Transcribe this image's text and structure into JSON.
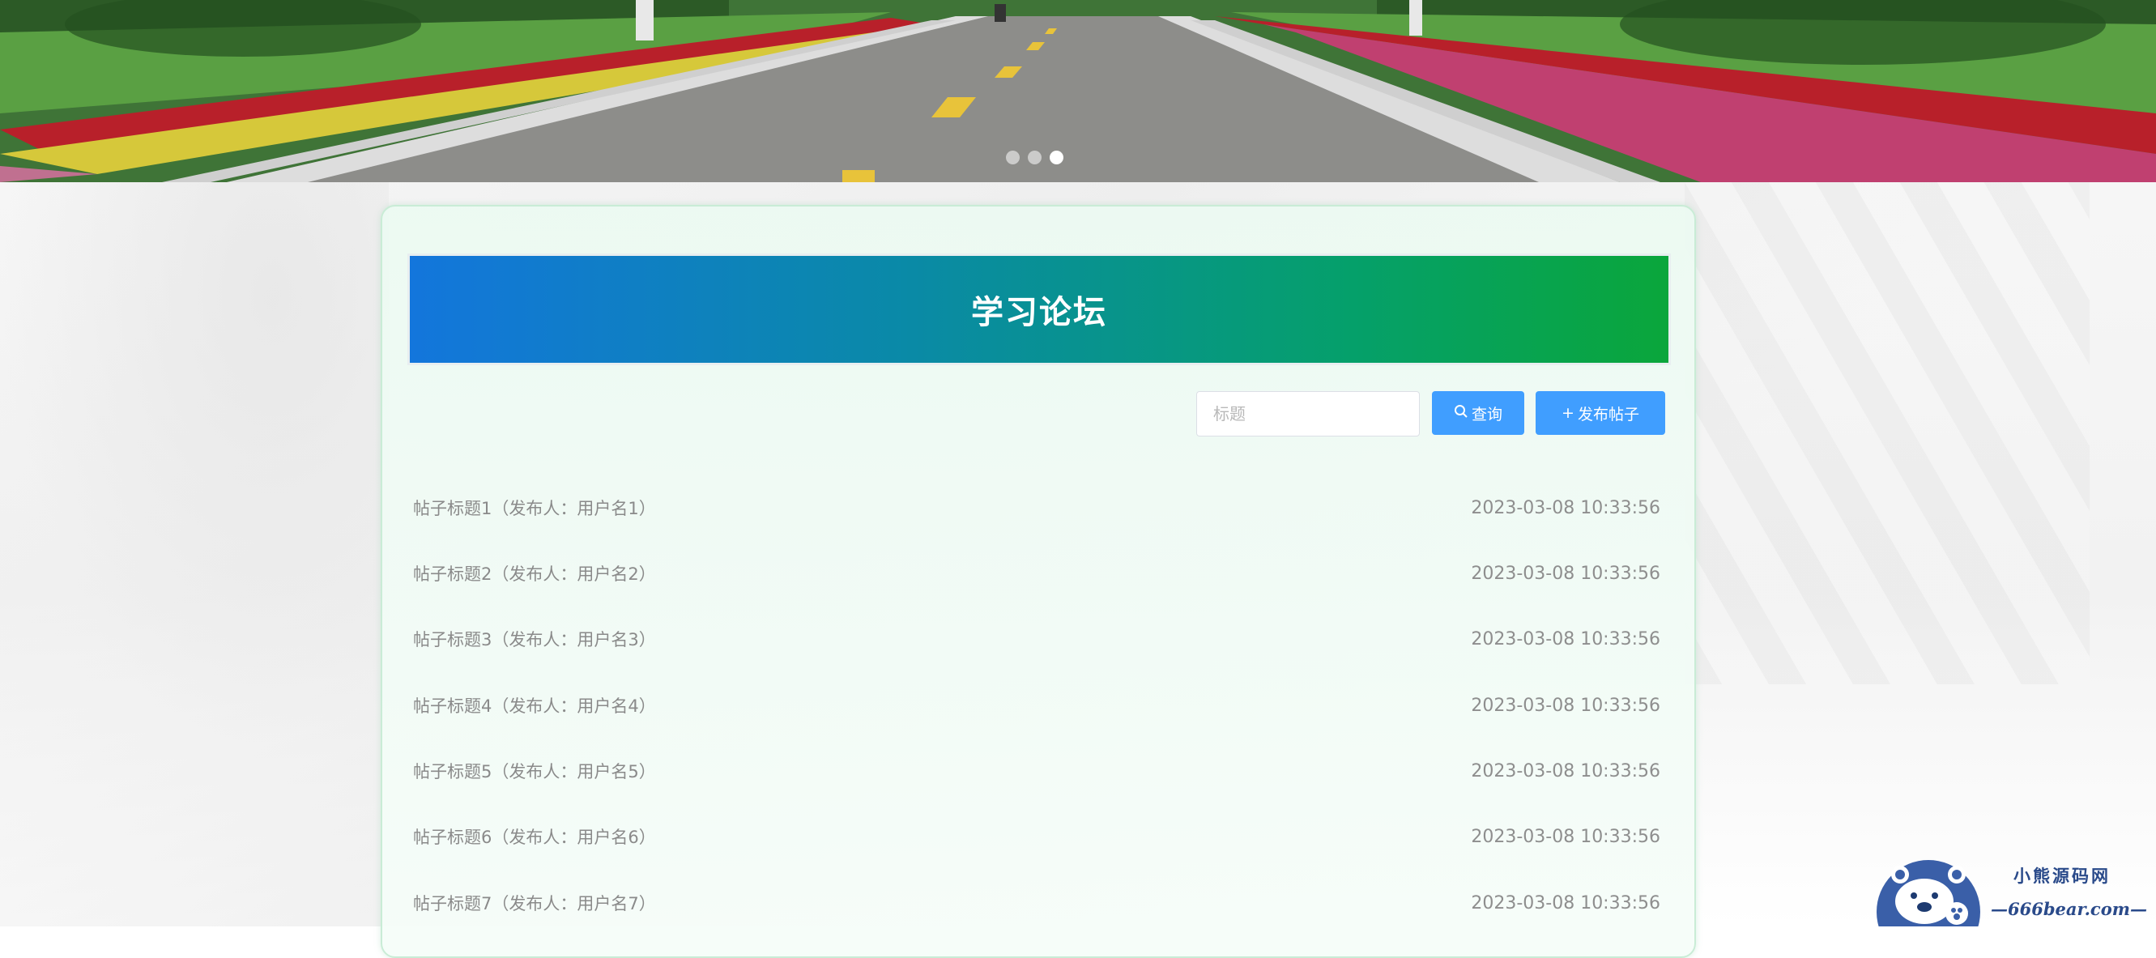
{
  "banner": {
    "dots": [
      {
        "active": false
      },
      {
        "active": false
      },
      {
        "active": true
      }
    ]
  },
  "forum": {
    "title": "学习论坛",
    "search": {
      "placeholder": "标题",
      "value": ""
    },
    "buttons": {
      "search_icon": "search-icon",
      "search_label": "查询",
      "post_icon": "plus-icon",
      "post_label": "发布帖子"
    },
    "posts": [
      {
        "title": "帖子标题1（发布人：用户名1）",
        "time": "2023-03-08 10:33:56"
      },
      {
        "title": "帖子标题2（发布人：用户名2）",
        "time": "2023-03-08 10:33:56"
      },
      {
        "title": "帖子标题3（发布人：用户名3）",
        "time": "2023-03-08 10:33:56"
      },
      {
        "title": "帖子标题4（发布人：用户名4）",
        "time": "2023-03-08 10:33:56"
      },
      {
        "title": "帖子标题5（发布人：用户名5）",
        "time": "2023-03-08 10:33:56"
      },
      {
        "title": "帖子标题6（发布人：用户名6）",
        "time": "2023-03-08 10:33:56"
      },
      {
        "title": "帖子标题7（发布人：用户名7）",
        "time": "2023-03-08 10:33:56"
      }
    ]
  },
  "watermark": {
    "name_cn": "小熊源码网",
    "name_en": "—666bear.com—"
  },
  "colors": {
    "primary_button": "#409eff",
    "title_gradient_start": "#1376dc",
    "title_gradient_end": "#0aa63b",
    "card_border": "#c9ecd6"
  }
}
